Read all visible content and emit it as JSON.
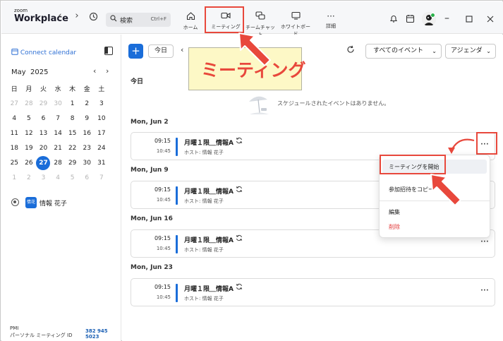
{
  "app": {
    "logo_small": "zoom",
    "logo_big": "Workplace",
    "search_placeholder": "検索",
    "search_shortcut": "Ctrl+F"
  },
  "tabs": [
    {
      "label": "ホーム",
      "icon": "home-icon"
    },
    {
      "label": "ミーティング",
      "icon": "video-icon"
    },
    {
      "label": "チームチャット",
      "icon": "chat-icon"
    },
    {
      "label": "ホワイトボード",
      "icon": "whiteboard-icon"
    },
    {
      "label": "詳細",
      "icon": "more-icon"
    }
  ],
  "sidebar": {
    "connect_calendar": "Connect calendar",
    "month": "May",
    "year": "2025",
    "weekdays": [
      "日",
      "月",
      "火",
      "水",
      "木",
      "金",
      "土"
    ],
    "weeks": [
      [
        {
          "d": "27",
          "dim": true
        },
        {
          "d": "28",
          "dim": true
        },
        {
          "d": "29",
          "dim": true
        },
        {
          "d": "30",
          "dim": true
        },
        {
          "d": "1"
        },
        {
          "d": "2"
        },
        {
          "d": "3"
        }
      ],
      [
        {
          "d": "4"
        },
        {
          "d": "5"
        },
        {
          "d": "6"
        },
        {
          "d": "7"
        },
        {
          "d": "8"
        },
        {
          "d": "9"
        },
        {
          "d": "10"
        }
      ],
      [
        {
          "d": "11"
        },
        {
          "d": "12"
        },
        {
          "d": "13"
        },
        {
          "d": "14"
        },
        {
          "d": "15"
        },
        {
          "d": "16"
        },
        {
          "d": "17"
        }
      ],
      [
        {
          "d": "18"
        },
        {
          "d": "19"
        },
        {
          "d": "20"
        },
        {
          "d": "21"
        },
        {
          "d": "22"
        },
        {
          "d": "23"
        },
        {
          "d": "24"
        }
      ],
      [
        {
          "d": "25"
        },
        {
          "d": "26"
        },
        {
          "d": "27",
          "selected": true
        },
        {
          "d": "28"
        },
        {
          "d": "29"
        },
        {
          "d": "30"
        },
        {
          "d": "31"
        }
      ],
      [
        {
          "d": "1",
          "dim": true
        },
        {
          "d": "2",
          "dim": true
        },
        {
          "d": "3",
          "dim": true
        },
        {
          "d": "4",
          "dim": true
        },
        {
          "d": "5",
          "dim": true
        },
        {
          "d": "6",
          "dim": true
        },
        {
          "d": "7",
          "dim": true
        }
      ]
    ],
    "person_badge": "情花",
    "person_name": "情報 花子",
    "pmi_label": "PMI",
    "pmi_sub": "パーソナル ミーティング ID",
    "pmi_number": "382 945 5023"
  },
  "toolbar": {
    "today_button": "今日",
    "events_filter": "すべてのイベント",
    "view_select": "アジェンダ"
  },
  "callout": "ミーティング",
  "agenda": {
    "today_label": "今日",
    "empty_text": "スケジュールされたイベントはありません。",
    "days": [
      {
        "label": "Mon, Jun 2",
        "start": "09:15",
        "end": "10:45",
        "title": "月曜１限＿情報A",
        "host": "ホスト: 情報 花子"
      },
      {
        "label": "Mon, Jun 9",
        "start": "09:15",
        "end": "10:45",
        "title": "月曜１限＿情報A",
        "host": "ホスト: 情報 花子"
      },
      {
        "label": "Mon, Jun 16",
        "start": "09:15",
        "end": "10:45",
        "title": "月曜１限＿情報A",
        "host": "ホスト: 情報 花子"
      },
      {
        "label": "Mon, Jun 23",
        "start": "09:15",
        "end": "10:45",
        "title": "月曜１限＿情報A",
        "host": "ホスト: 情報 花子"
      }
    ]
  },
  "menu": {
    "start": "ミーティングを開始",
    "copy": "参加招待をコピー",
    "edit": "編集",
    "delete": "削除"
  },
  "colors": {
    "accent": "#1a6dd9",
    "highlight": "#e8483c",
    "danger": "#e23b3b",
    "callout_bg": "#fdf8c6"
  }
}
